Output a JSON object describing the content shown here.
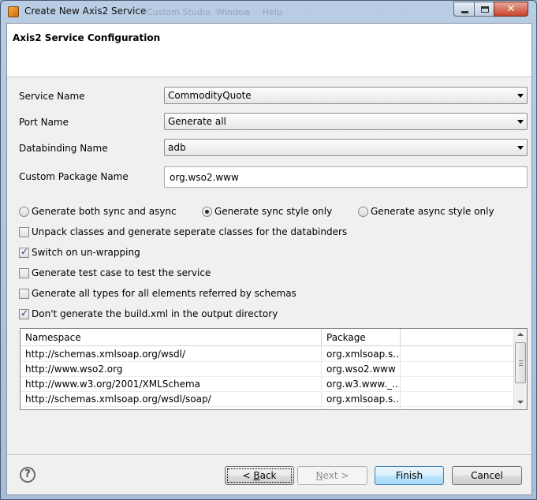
{
  "window": {
    "title": "Create New Axis2 Service",
    "behind_menu": [
      "Custom Studio",
      "Window",
      "Help"
    ]
  },
  "banner": {
    "title": "Axis2 Service Configuration"
  },
  "form": {
    "service_name": {
      "label": "Service Name",
      "value": "CommodityQuote"
    },
    "port_name": {
      "label": "Port Name",
      "value": "Generate all"
    },
    "databinding_name": {
      "label": "Databinding Name",
      "value": "adb"
    },
    "custom_package_name": {
      "label": "Custom Package Name",
      "value": "org.wso2.www"
    }
  },
  "radios": [
    {
      "label": "Generate both sync and async",
      "checked": false
    },
    {
      "label": "Generate sync style only",
      "checked": true
    },
    {
      "label": "Generate async style only",
      "checked": false
    }
  ],
  "checkboxes": [
    {
      "label": "Unpack classes and generate seperate classes for the databinders",
      "checked": false
    },
    {
      "label": "Switch on un-wrapping",
      "checked": true
    },
    {
      "label": "Generate test case to test the service",
      "checked": false
    },
    {
      "label": "Generate all types for all elements referred by schemas",
      "checked": false
    },
    {
      "label": "Don't generate the build.xml in the output directory",
      "checked": true
    }
  ],
  "table": {
    "headers": [
      "Namespace",
      "Package"
    ],
    "rows": [
      [
        "http://schemas.xmlsoap.org/wsdl/",
        "org.xmlsoap.s..."
      ],
      [
        "http://www.wso2.org",
        "org.wso2.www"
      ],
      [
        "http://www.w3.org/2001/XMLSchema",
        "org.w3.www._..."
      ],
      [
        "http://schemas.xmlsoap.org/wsdl/soap/",
        "org.xmlsoap.s..."
      ]
    ]
  },
  "buttons": {
    "back": {
      "prefix": "< ",
      "mnemonic": "B",
      "rest": "ack"
    },
    "next": {
      "mnemonic": "N",
      "rest": "ext >"
    },
    "finish": "Finish",
    "cancel": "Cancel"
  },
  "help_icon": "question-mark-icon"
}
